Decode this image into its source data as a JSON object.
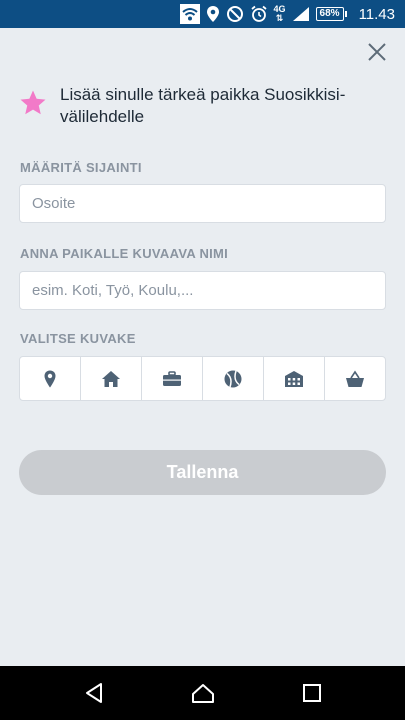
{
  "status_bar": {
    "network_type": "4G",
    "battery": "68%",
    "time": "11.43"
  },
  "header": {
    "title": "Lisää sinulle tärkeä paikka Suosikkisi-välilehdelle"
  },
  "location": {
    "label": "MÄÄRITÄ SIJAINTI",
    "placeholder": "Osoite"
  },
  "name": {
    "label": "ANNA PAIKALLE KUVAAVA NIMI",
    "placeholder": "esim. Koti, Työ, Koulu,..."
  },
  "icons": {
    "label": "VALITSE KUVAKE",
    "items": [
      "location-pin",
      "home",
      "briefcase",
      "ball",
      "building",
      "basket"
    ]
  },
  "save_button": {
    "label": "Tallenna"
  },
  "colors": {
    "status_bar": "#0d4e84",
    "background": "#e9edf1",
    "star": "#f27ac8",
    "icon": "#4e6275",
    "button_disabled": "#c9ccd0"
  }
}
